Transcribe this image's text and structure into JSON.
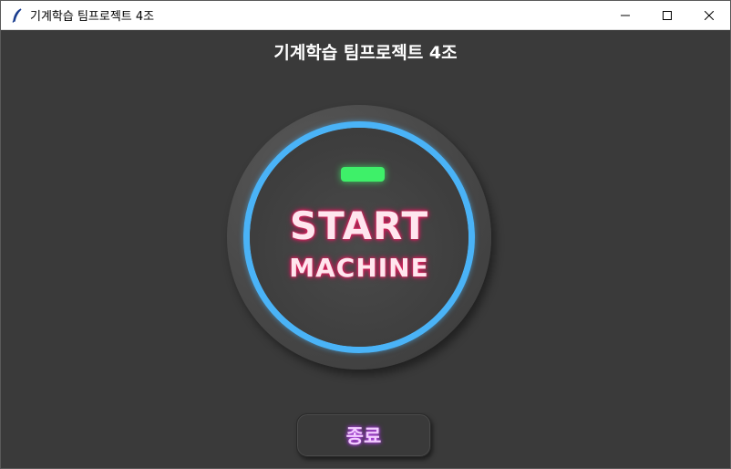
{
  "window": {
    "title": "기계학습 팀프로젝트 4조",
    "app_icon": "feather-icon"
  },
  "main": {
    "heading": "기계학습 팀프로젝트 4조",
    "start_button": {
      "line1": "START",
      "line2": "MACHINE",
      "ring_color": "#4ab3f7",
      "led_color": "#3ef069",
      "text_glow_color": "#e0245e"
    },
    "exit_button": {
      "label": "종료",
      "glow_color": "#c04cf0"
    }
  },
  "colors": {
    "background": "#3a3a3a",
    "heading_text": "#ffffff"
  }
}
